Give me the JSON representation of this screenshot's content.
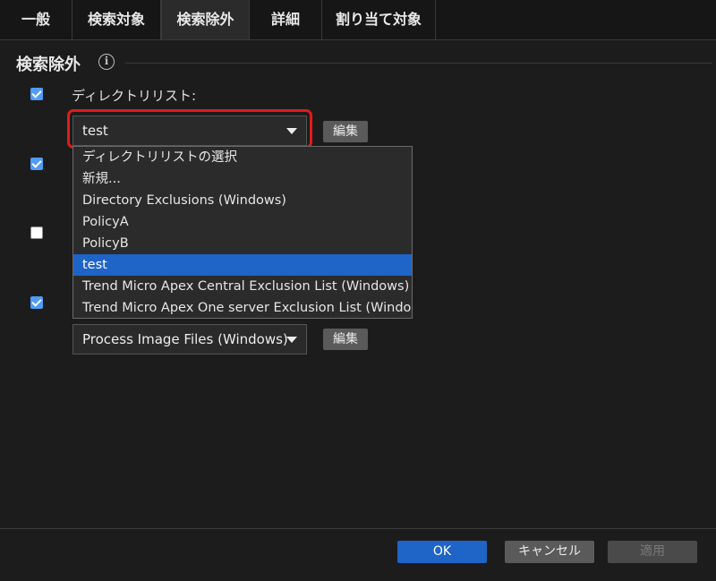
{
  "tabs": [
    "一般",
    "検索対象",
    "検索除外",
    "詳細",
    "割り当て対象"
  ],
  "section": {
    "title": "検索除外",
    "info_glyph": "i"
  },
  "directory_list": {
    "label": "ディレクトリリスト:",
    "selected": "test",
    "edit_label": "編集",
    "options": [
      "ディレクトリリストの選択",
      "新規...",
      "Directory Exclusions (Windows)",
      "PolicyA",
      "PolicyB",
      "test",
      "Trend Micro Apex Central Exclusion List (Windows)",
      "Trend Micro Apex One server Exclusion List (Windows)"
    ],
    "highlighted_option": "test"
  },
  "process_list": {
    "selected": "Process Image Files (Windows)",
    "edit_label": "編集"
  },
  "checkboxes": {
    "row1": true,
    "row2": true,
    "row3": false,
    "row4": true
  },
  "footer": {
    "ok": "OK",
    "cancel": "キャンセル",
    "apply": "適用"
  },
  "colors": {
    "accent": "#1f64c7",
    "highlight_border": "#e01b1b",
    "checkbox": "#4f9cf7"
  }
}
